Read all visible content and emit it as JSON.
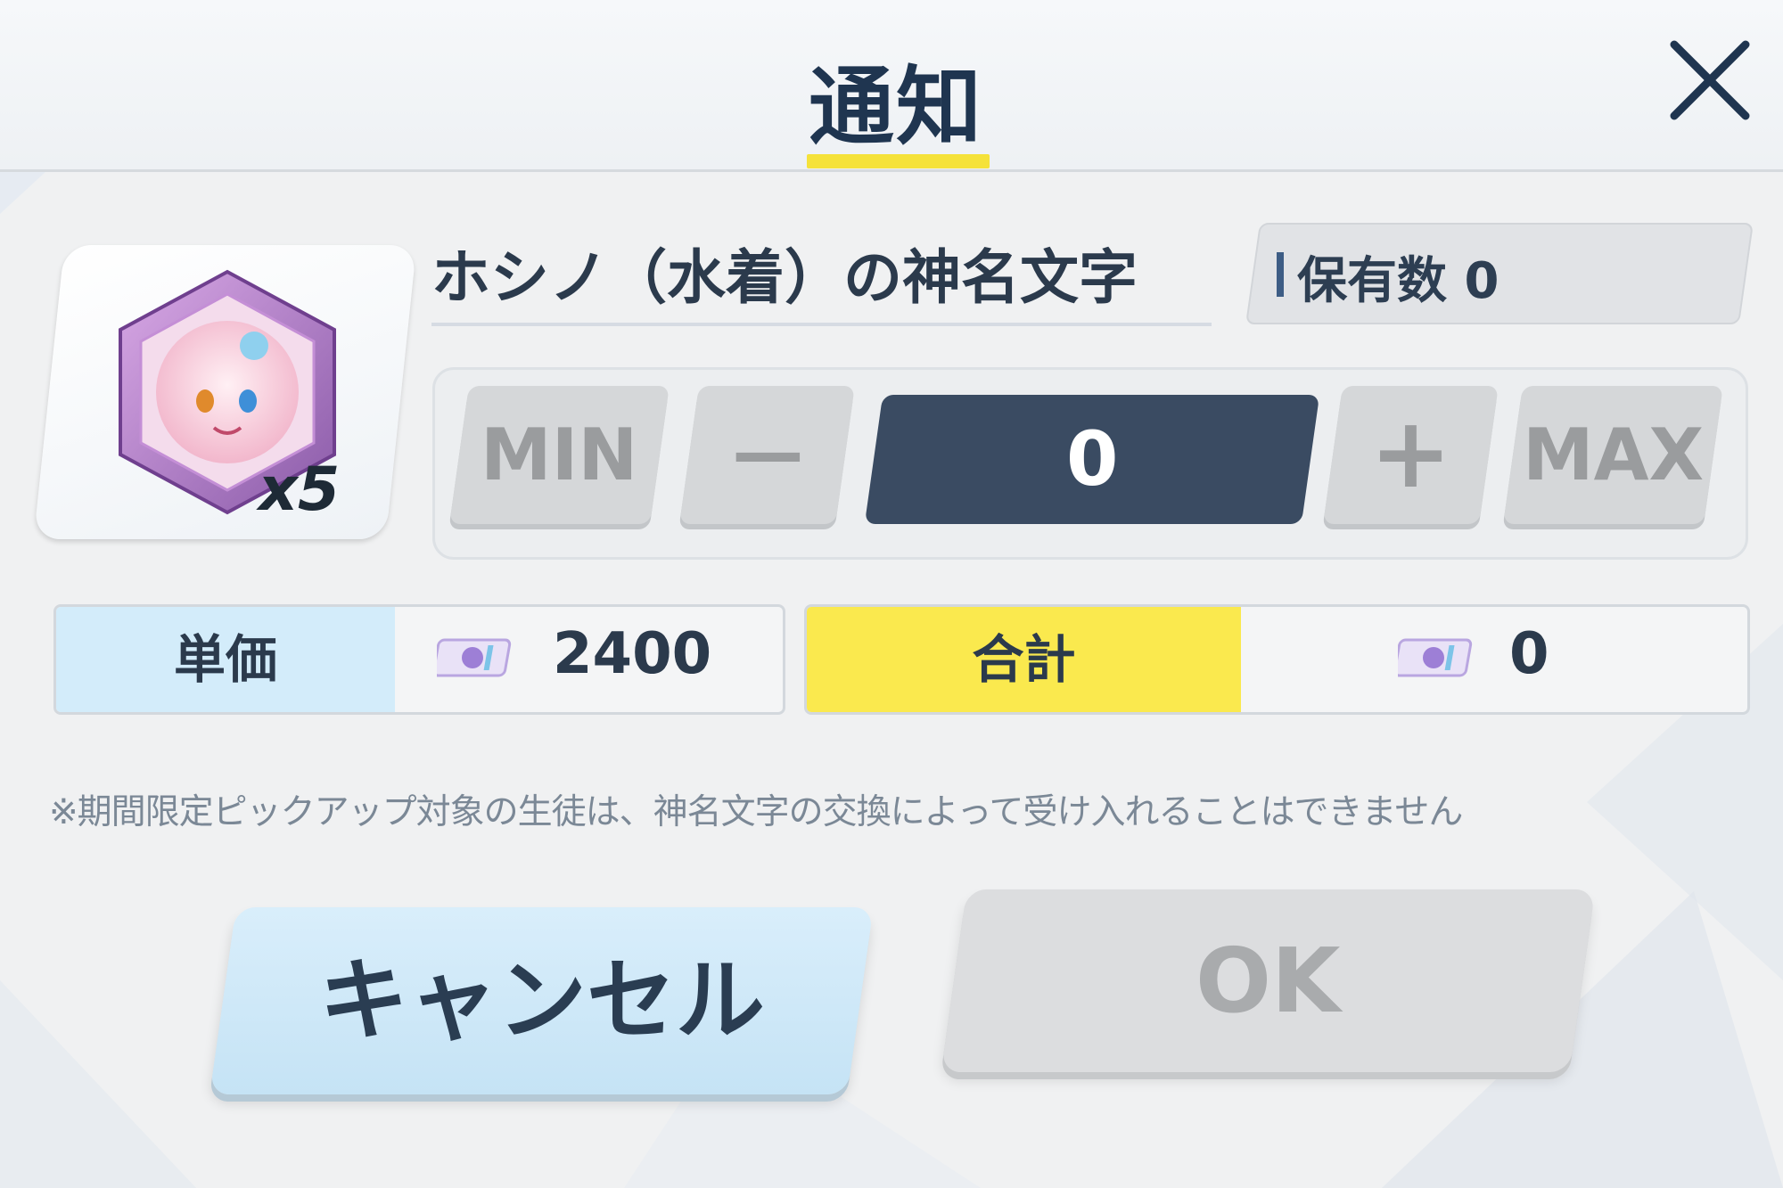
{
  "dialog": {
    "title": "通知",
    "close_icon": "close-icon"
  },
  "item": {
    "name": "ホシノ（水着）の神名文字",
    "count_label": "x5",
    "icon": "hoshino-eleph-icon",
    "owned_label": "保有数 0"
  },
  "quantity": {
    "min_label": "MIN",
    "minus_label": "—",
    "value": "0",
    "plus_label": "+",
    "max_label": "MAX"
  },
  "price": {
    "unit_label": "単価",
    "unit_value": "2400",
    "total_label": "合計",
    "total_value": "0",
    "currency_icon": "ticket-icon"
  },
  "notice": "※期間限定ピックアップ対象の生徒は、神名文字の交換によって受け入れることはできません",
  "buttons": {
    "cancel_label": "キャンセル",
    "ok_label": "OK"
  },
  "colors": {
    "title_underline": "#f5e23a",
    "qty_display": "#3a4b62",
    "unit_label_bg": "#d3ecfa",
    "total_label_bg": "#fae94e",
    "cancel_bg": "#c5e3f5",
    "ok_disabled_bg": "#dcdddf"
  }
}
